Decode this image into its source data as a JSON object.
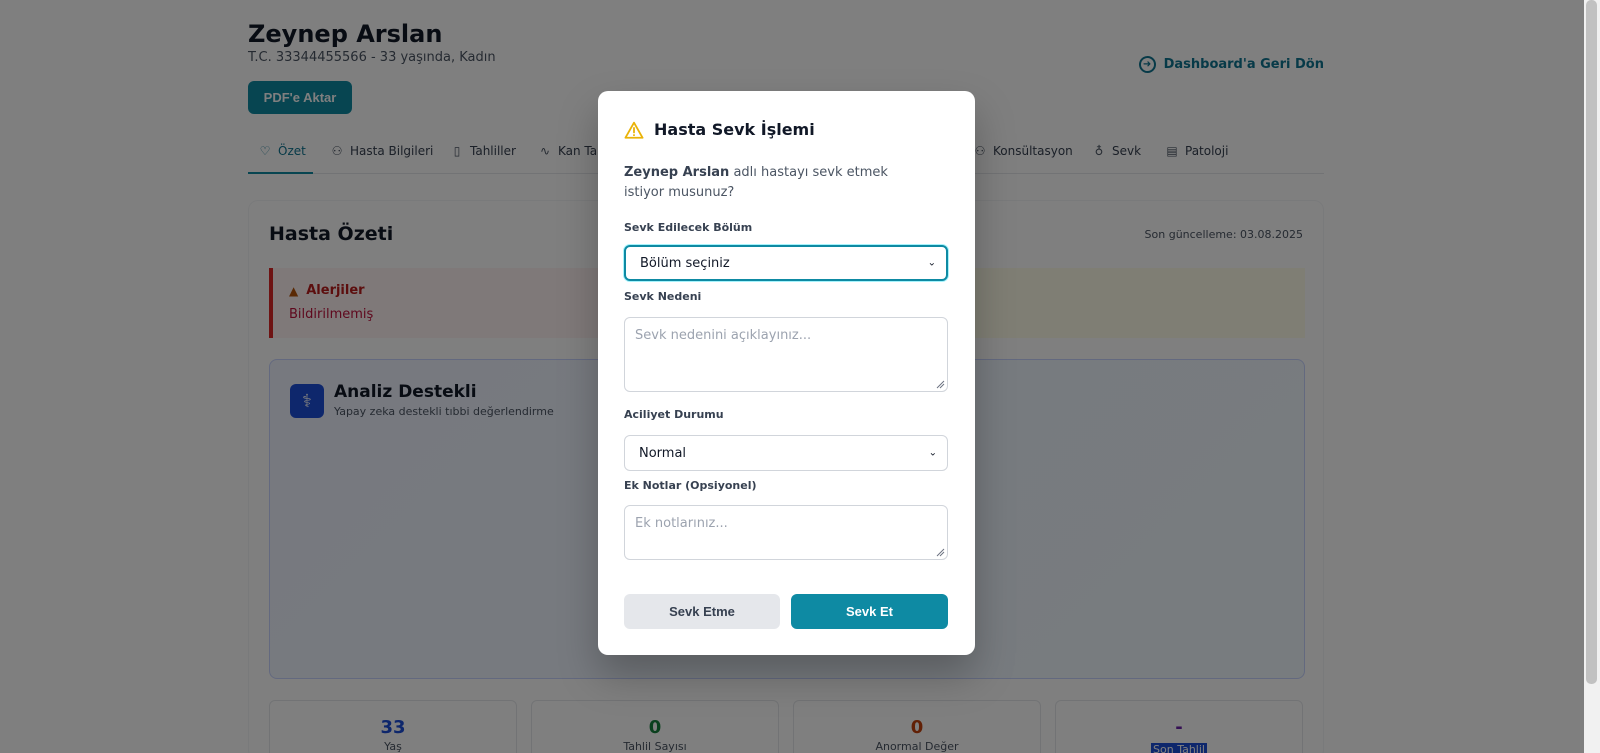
{
  "header": {
    "patient_name": "Zeynep Arslan",
    "patient_meta": "T.C. 33344455566 - 33 yaşında, Kadın",
    "pdf_button": "PDF'e Aktar",
    "back_link": "Dashboard'a Geri Dön"
  },
  "tabs": [
    {
      "label": "Özet",
      "icon": "heart-pulse-icon",
      "active": true
    },
    {
      "label": "Hasta Bilgileri",
      "icon": "user-icon"
    },
    {
      "label": "Tahliller",
      "icon": "file-icon"
    },
    {
      "label": "Kan Tahlilleri",
      "icon": "activity-icon"
    },
    {
      "label": "Konsültasyon",
      "icon": "users-icon"
    },
    {
      "label": "Sevk",
      "icon": "stethoscope-icon"
    },
    {
      "label": "Patoloji",
      "icon": "file-text-icon"
    }
  ],
  "summary": {
    "title": "Hasta Özeti",
    "last_update": "Son güncelleme: 03.08.2025",
    "allergy_title": "Alerjiler",
    "allergy_value": "Bildirilmemiş",
    "analysis_title": "Analiz Destekli",
    "analysis_subtitle": "Yapay zeka destekli tıbbi değerlendirme",
    "stats": [
      {
        "value": "33",
        "label": "Yaş",
        "color": "#1d4ed8"
      },
      {
        "value": "0",
        "label": "Tahlil Sayısı",
        "color": "#15803d"
      },
      {
        "value": "0",
        "label": "Anormal Değer",
        "color": "#c2410c"
      },
      {
        "value": "-",
        "label": "Son Tahlil",
        "color": "#6b21a8"
      }
    ]
  },
  "modal": {
    "title": "Hasta Sevk İşlemi",
    "question_name": "Zeynep Arslan",
    "question_rest": " adlı hastayı sevk etmek istiyor musunuz?",
    "department_label": "Sevk Edilecek Bölüm",
    "department_value": "Bölüm seçiniz",
    "reason_label": "Sevk Nedeni",
    "reason_placeholder": "Sevk nedenini açıklayınız...",
    "urgency_label": "Aciliyet Durumu",
    "urgency_value": "Normal",
    "notes_label": "Ek Notlar (Opsiyonel)",
    "notes_placeholder": "Ek notlarınız...",
    "cancel_button": "Sevk Etme",
    "submit_button": "Sevk Et"
  },
  "colors": {
    "primary": "#0e8aa3",
    "warning": "#eab308",
    "danger": "#dc2626"
  }
}
